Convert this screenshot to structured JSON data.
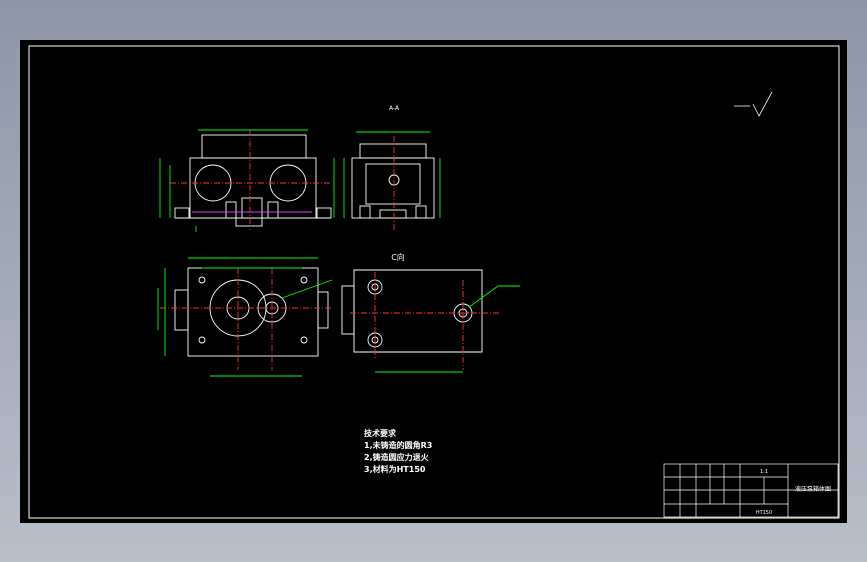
{
  "section_label": "A-A",
  "view_label": "C向",
  "technical_requirements": {
    "heading": "技术要求",
    "items": [
      "1,未铸造的圆角R3",
      "2,铸造圆应力退火",
      "3,材料为HT150"
    ]
  },
  "title_block": {
    "part_name": "液压泵箱体图",
    "scale": "1:1",
    "material": "HT150"
  },
  "colors": {
    "background": "#000000",
    "geometry": "#ffffff",
    "dimension": "#00ff00",
    "center": "#ff3030",
    "frame": "#ffffff",
    "desktop": "#a3aab6"
  }
}
